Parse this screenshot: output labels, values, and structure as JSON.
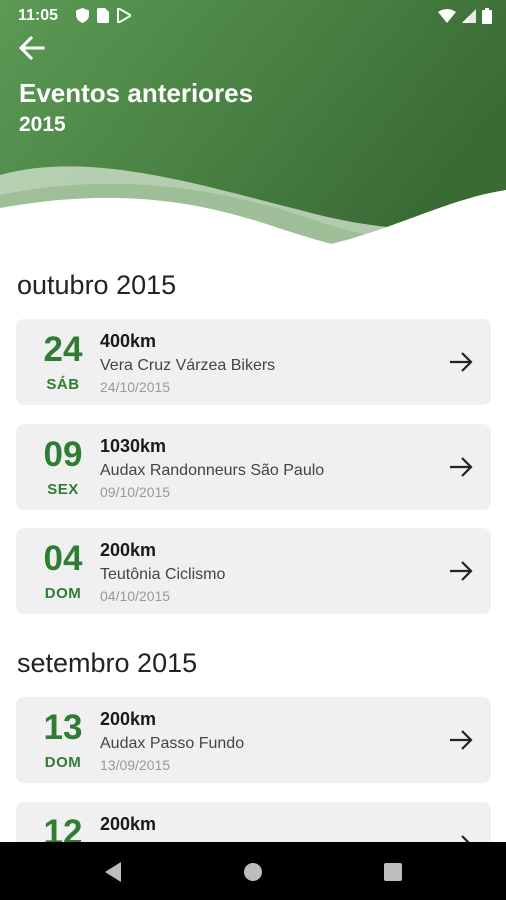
{
  "status_bar": {
    "time": "11:05",
    "icons": [
      "shield-icon",
      "sim-card-icon",
      "play-store-icon",
      "wifi-icon",
      "signal-icon",
      "battery-icon"
    ]
  },
  "header": {
    "title": "Eventos anteriores",
    "subtitle": "2015",
    "back_icon": "arrow-back-icon",
    "accent_color": "#3f7a3a"
  },
  "sections": [
    {
      "month": "outubro 2015",
      "events": [
        {
          "day": "24",
          "weekday": "SÁB",
          "distance": "400km",
          "club": "Vera Cruz Várzea Bikers",
          "date": "24/10/2015"
        },
        {
          "day": "09",
          "weekday": "SEX",
          "distance": "1030km",
          "club": "Audax Randonneurs São Paulo",
          "date": "09/10/2015"
        },
        {
          "day": "04",
          "weekday": "DOM",
          "distance": "200km",
          "club": "Teutônia Ciclismo",
          "date": "04/10/2015"
        }
      ]
    },
    {
      "month": "setembro 2015",
      "events": [
        {
          "day": "13",
          "weekday": "DOM",
          "distance": "200km",
          "club": "Audax Passo Fundo",
          "date": "13/09/2015"
        },
        {
          "day": "12",
          "weekday": "",
          "distance": "200km",
          "club": "",
          "date": ""
        }
      ]
    }
  ],
  "nav_bar": {
    "icons": [
      "back-triangle-icon",
      "home-circle-icon",
      "recents-square-icon"
    ]
  },
  "colors": {
    "green": "#2e7d32",
    "card_bg": "#f0f0f0"
  }
}
